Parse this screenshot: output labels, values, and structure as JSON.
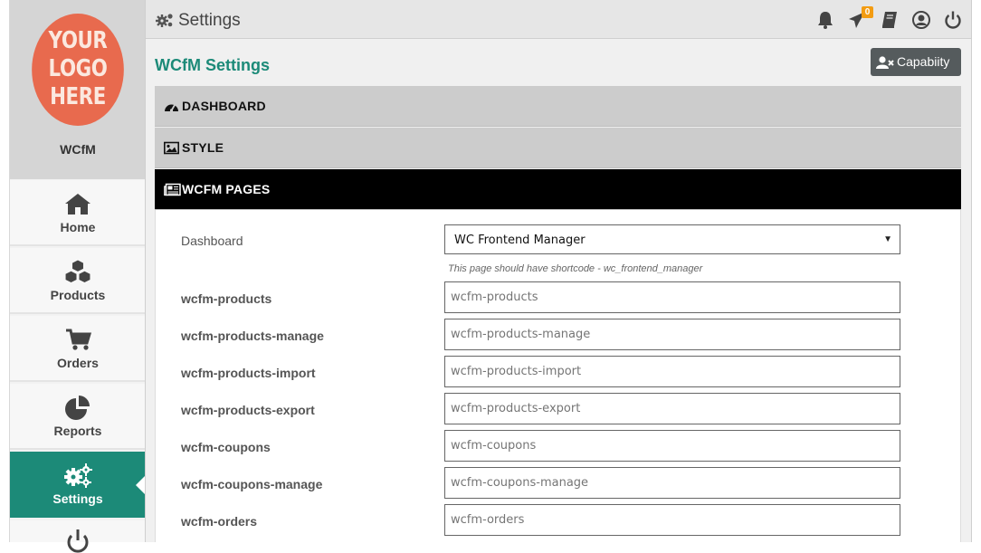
{
  "logo": {
    "line1": "YOUR",
    "line2": "LOGO",
    "line3": "HERE"
  },
  "store_name": "WCfM",
  "sidebar": {
    "items": [
      {
        "label": "Home",
        "icon": "home-icon"
      },
      {
        "label": "Products",
        "icon": "cubes-icon"
      },
      {
        "label": "Orders",
        "icon": "cart-icon"
      },
      {
        "label": "Reports",
        "icon": "pie-chart-icon"
      },
      {
        "label": "Settings",
        "icon": "cogs-icon",
        "active": true
      },
      {
        "label": "",
        "icon": "power-icon"
      }
    ]
  },
  "topbar": {
    "title": "Settings",
    "notification_count": "0",
    "icons": [
      "bell-icon",
      "paper-plane-icon",
      "book-icon",
      "user-circle-icon",
      "power-icon"
    ]
  },
  "page": {
    "heading": "WCfM Settings",
    "capability_button": "Capabiity"
  },
  "sections": [
    {
      "label": "DASHBOARD",
      "icon": "dashboard-icon",
      "open": false
    },
    {
      "label": "STYLE",
      "icon": "image-icon",
      "open": false
    },
    {
      "label": "WCFM PAGES",
      "icon": "newspaper-icon",
      "open": true
    }
  ],
  "fields": {
    "dashboard": {
      "label": "Dashboard",
      "selected": "WC Frontend Manager",
      "hint": "This page should have shortcode - wc_frontend_manager"
    },
    "rows": [
      {
        "label": "wcfm-products",
        "placeholder": "wcfm-products"
      },
      {
        "label": "wcfm-products-manage",
        "placeholder": "wcfm-products-manage"
      },
      {
        "label": "wcfm-products-import",
        "placeholder": "wcfm-products-import"
      },
      {
        "label": "wcfm-products-export",
        "placeholder": "wcfm-products-export"
      },
      {
        "label": "wcfm-coupons",
        "placeholder": "wcfm-coupons"
      },
      {
        "label": "wcfm-coupons-manage",
        "placeholder": "wcfm-coupons-manage"
      },
      {
        "label": "wcfm-orders",
        "placeholder": "wcfm-orders"
      }
    ]
  },
  "colors": {
    "accent": "#1c8a78",
    "logo": "#e86a4e",
    "badge": "#f39c12",
    "open_section": "#000000"
  }
}
